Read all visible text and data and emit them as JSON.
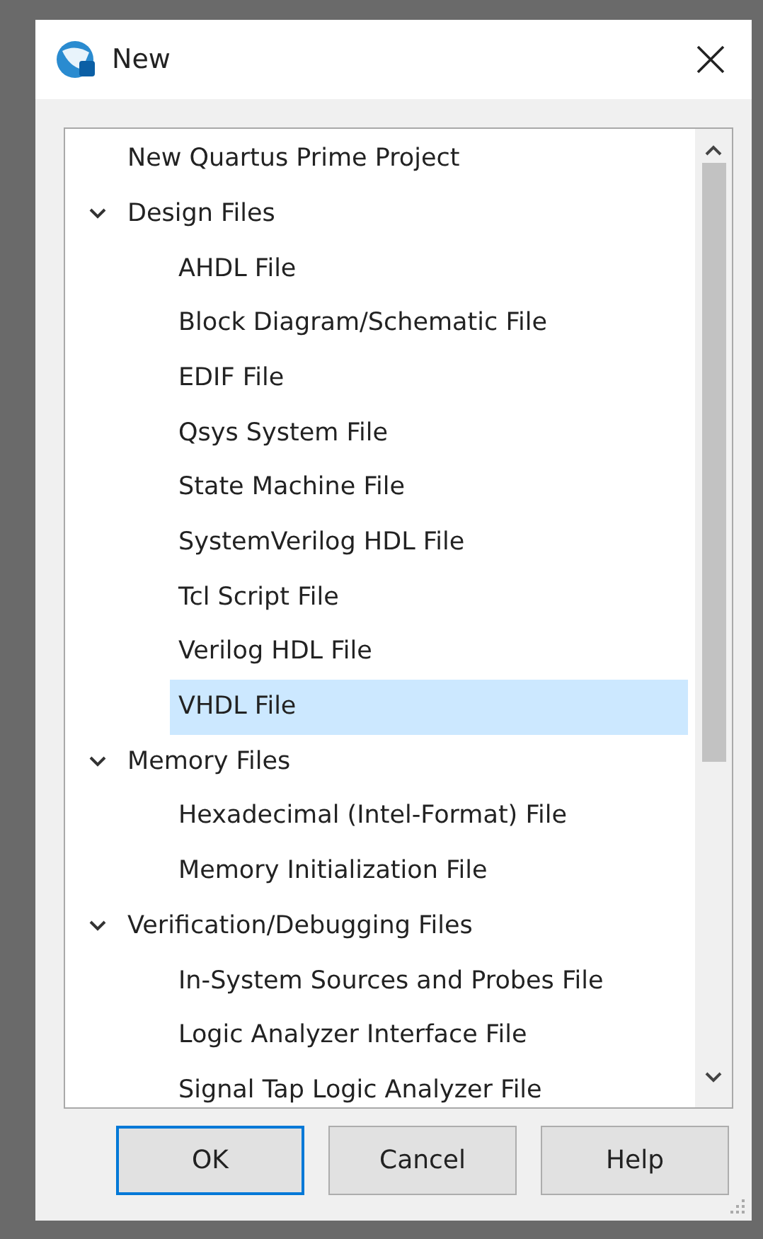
{
  "window": {
    "title": "New"
  },
  "tree": [
    {
      "label": "New Quartus Prime Project",
      "selected": false
    },
    {
      "label": "Design Files",
      "expanded": true,
      "selected": false,
      "children": [
        {
          "label": "AHDL File",
          "selected": false
        },
        {
          "label": "Block Diagram/Schematic File",
          "selected": false
        },
        {
          "label": "EDIF File",
          "selected": false
        },
        {
          "label": "Qsys System File",
          "selected": false
        },
        {
          "label": "State Machine File",
          "selected": false
        },
        {
          "label": "SystemVerilog HDL File",
          "selected": false
        },
        {
          "label": "Tcl Script File",
          "selected": false
        },
        {
          "label": "Verilog HDL File",
          "selected": false
        },
        {
          "label": "VHDL File",
          "selected": true
        }
      ]
    },
    {
      "label": "Memory Files",
      "expanded": true,
      "selected": false,
      "children": [
        {
          "label": "Hexadecimal (Intel-Format) File",
          "selected": false
        },
        {
          "label": "Memory Initialization File",
          "selected": false
        }
      ]
    },
    {
      "label": "Verification/Debugging Files",
      "expanded": true,
      "selected": false,
      "children": [
        {
          "label": "In-System Sources and Probes File",
          "selected": false
        },
        {
          "label": "Logic Analyzer Interface File",
          "selected": false
        },
        {
          "label": "Signal Tap Logic Analyzer File",
          "selected": false
        }
      ]
    }
  ],
  "buttons": [
    {
      "label": "OK",
      "default": true
    },
    {
      "label": "Cancel",
      "default": false
    },
    {
      "label": "Help",
      "default": false
    }
  ]
}
